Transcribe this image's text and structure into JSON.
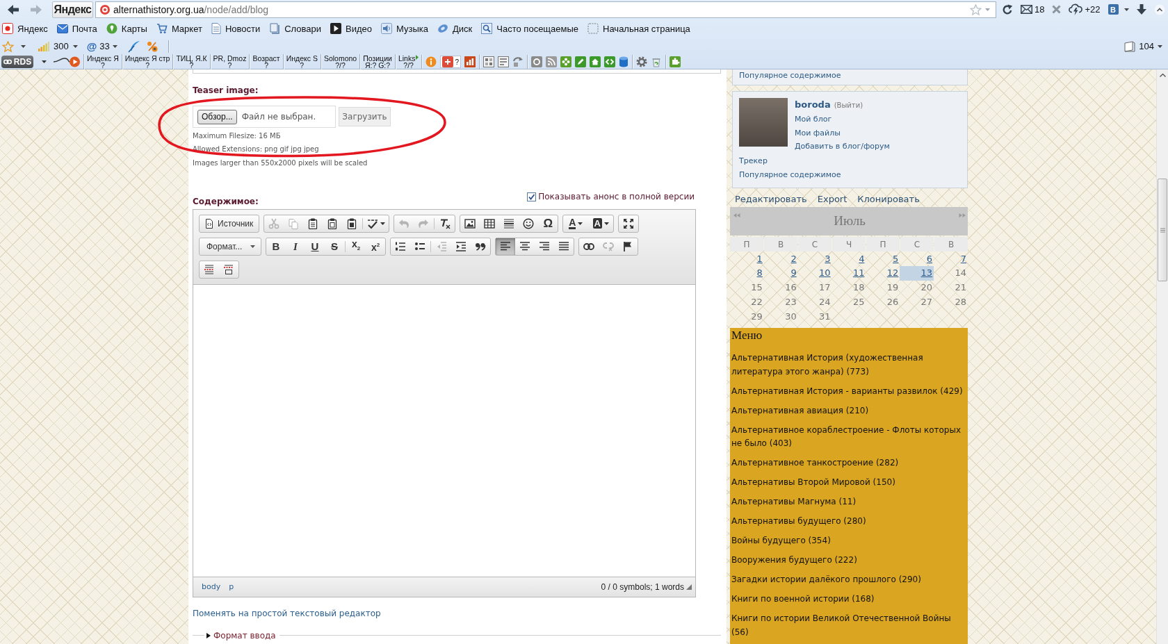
{
  "browser": {
    "nav": [
      {
        "kind": "back",
        "disabled": false
      },
      {
        "kind": "forward",
        "disabled": true
      }
    ],
    "home_button": "Яндекс",
    "address": {
      "host": "alternathistory.org.ua",
      "path": "/node/add/blog"
    },
    "tools": [
      {
        "kind": "refresh"
      },
      {
        "kind": "mail",
        "text": "18"
      },
      {
        "kind": "close"
      },
      {
        "kind": "weather",
        "text": "+22"
      },
      {
        "kind": "account",
        "text": "B"
      },
      {
        "kind": "download"
      },
      {
        "kind": "collapse"
      }
    ],
    "bookmarks": [
      {
        "kind": "yandex",
        "label": "Яндекс"
      },
      {
        "kind": "mail",
        "label": "Почта"
      },
      {
        "kind": "maps",
        "label": "Карты"
      },
      {
        "kind": "market",
        "label": "Маркет"
      },
      {
        "kind": "news",
        "label": "Новости"
      },
      {
        "kind": "dictionary",
        "label": "Словари"
      },
      {
        "kind": "video",
        "label": "Видео"
      },
      {
        "kind": "music",
        "label": "Музыка"
      },
      {
        "kind": "disk",
        "label": "Диск"
      },
      {
        "kind": "frequent",
        "label": "Часто посещаемые"
      },
      {
        "kind": "start",
        "label": "Начальная страница"
      }
    ],
    "widgets": [
      {
        "kind": "favorites"
      },
      {
        "kind": "rating",
        "text": "300"
      },
      {
        "kind": "mail-count",
        "glyph": "@",
        "text": "33"
      },
      {
        "kind": "feather"
      },
      {
        "kind": "percent"
      }
    ],
    "pages_counter": "104",
    "rds": {
      "badge": "RDS",
      "metrics": [
        {
          "kind": "plain",
          "label": "Индекс Я",
          "value": "?"
        },
        {
          "kind": "plain",
          "label": "Индекс Я стр",
          "value": "?"
        },
        {
          "kind": "plain",
          "label": "ТИЦ, Я.К",
          "value": "?"
        },
        {
          "kind": "plain",
          "label": "PR, Dmoz",
          "value": "?"
        },
        {
          "kind": "plain",
          "label": "Возраст",
          "value": "?"
        },
        {
          "kind": "plain",
          "label": "Индекс S",
          "value": "?"
        },
        {
          "kind": "plain",
          "label": "Solomono",
          "value": "?/?"
        },
        {
          "kind": "plain",
          "label": "Позиции",
          "value": "Я:? G:?"
        },
        {
          "kind": "dropdown",
          "label": "Links",
          "value": "?/?"
        }
      ],
      "tools": [
        [
          {
            "kind": "info"
          },
          {
            "kind": "plus",
            "text": "?"
          },
          {
            "kind": "chart"
          }
        ],
        [
          {
            "kind": "grid"
          },
          {
            "kind": "lines"
          },
          {
            "kind": "rotate"
          }
        ],
        [
          {
            "kind": "coin"
          },
          {
            "kind": "rss"
          },
          {
            "kind": "flower"
          },
          {
            "kind": "pencil"
          },
          {
            "kind": "home"
          },
          {
            "kind": "code"
          },
          {
            "kind": "database"
          }
        ],
        [
          {
            "kind": "gear"
          },
          {
            "kind": "recycle"
          }
        ],
        [
          {
            "kind": "puzzle"
          }
        ]
      ]
    }
  },
  "form": {
    "teaser": {
      "label": "Teaser image:",
      "browse_button": "Обзор...",
      "file_status": "Файл не выбран.",
      "upload_button": "Загрузить",
      "hints": [
        "Maximum Filesize: 16 МБ",
        "Allowed Extensions: png gif jpg jpeg",
        "Images larger than 550x2000 pixels will be scaled"
      ]
    },
    "annotations": [
      {
        "kind": "ellipse"
      }
    ],
    "content": {
      "label": "Содержимое:",
      "show_teaser": {
        "label": "Показывать анонс в полной версии",
        "checked": true
      },
      "editor": {
        "toolbar": [
          [
            [
              [
                {
                  "kind": "source",
                  "label": "Источник",
                  "disabled": false,
                  "selected": false
                }
              ]
            ],
            [
              [
                {
                  "kind": "cut",
                  "disabled": true,
                  "selected": false
                },
                {
                  "kind": "copy",
                  "disabled": true,
                  "selected": false
                },
                {
                  "kind": "paste",
                  "disabled": false,
                  "selected": false
                },
                {
                  "kind": "paste-text",
                  "disabled": false,
                  "selected": false
                },
                {
                  "kind": "paste-word",
                  "disabled": false,
                  "selected": false
                }
              ],
              [
                {
                  "kind": "spellcheck",
                  "disabled": false,
                  "selected": false
                }
              ]
            ],
            [
              [
                {
                  "kind": "undo",
                  "disabled": true,
                  "selected": false
                },
                {
                  "kind": "redo",
                  "disabled": true,
                  "selected": false
                }
              ],
              [
                {
                  "kind": "remove-format",
                  "disabled": false,
                  "selected": false
                }
              ]
            ],
            [
              [
                {
                  "kind": "image",
                  "disabled": false,
                  "selected": false
                },
                {
                  "kind": "table",
                  "disabled": false,
                  "selected": false
                },
                {
                  "kind": "rule",
                  "disabled": false,
                  "selected": false
                },
                {
                  "kind": "smiley",
                  "disabled": false,
                  "selected": false
                },
                {
                  "kind": "special-char",
                  "glyph": "Ω",
                  "disabled": false,
                  "selected": false
                }
              ]
            ],
            [
              [
                {
                  "kind": "text-color",
                  "glyph": "A",
                  "disabled": false,
                  "selected": false
                },
                {
                  "kind": "bg-color",
                  "glyph": "A",
                  "disabled": false,
                  "selected": false
                }
              ]
            ],
            [
              [
                {
                  "kind": "maximize",
                  "disabled": false,
                  "selected": false
                }
              ]
            ]
          ],
          [
            [
              [
                {
                  "kind": "format",
                  "label": "Формат...",
                  "disabled": false,
                  "selected": false
                }
              ]
            ],
            [
              [
                {
                  "kind": "bold",
                  "glyph": "B",
                  "disabled": false,
                  "selected": false
                },
                {
                  "kind": "italic",
                  "glyph": "I",
                  "disabled": false,
                  "selected": false
                },
                {
                  "kind": "underline",
                  "glyph": "U",
                  "disabled": false,
                  "selected": false
                },
                {
                  "kind": "strike",
                  "glyph": "S",
                  "disabled": false,
                  "selected": false
                }
              ],
              [
                {
                  "kind": "subscript",
                  "glyph": "x$_{2}$",
                  "disabled": false,
                  "selected": false
                },
                {
                  "kind": "superscript",
                  "glyph": "x$^{2}$",
                  "disabled": false,
                  "selected": false
                }
              ]
            ],
            [
              [
                {
                  "kind": "numbered-list",
                  "disabled": false,
                  "selected": false
                },
                {
                  "kind": "bullet-list",
                  "disabled": false,
                  "selected": false
                }
              ],
              [
                {
                  "kind": "outdent",
                  "disabled": true,
                  "selected": false
                },
                {
                  "kind": "indent",
                  "disabled": false,
                  "selected": false
                },
                {
                  "kind": "blockquote",
                  "disabled": false,
                  "selected": false
                }
              ]
            ],
            [
              [
                {
                  "kind": "align-left",
                  "disabled": false,
                  "selected": true
                },
                {
                  "kind": "align-center",
                  "disabled": false,
                  "selected": false
                },
                {
                  "kind": "align-right",
                  "disabled": false,
                  "selected": false
                },
                {
                  "kind": "justify",
                  "disabled": false,
                  "selected": false
                }
              ]
            ],
            [
              [
                {
                  "kind": "link",
                  "disabled": false,
                  "selected": false
                },
                {
                  "kind": "unlink",
                  "disabled": true,
                  "selected": false
                },
                {
                  "kind": "anchor",
                  "disabled": false,
                  "selected": false
                }
              ]
            ]
          ],
          [
            [
              [
                {
                  "kind": "page-break",
                  "disabled": false,
                  "selected": false
                },
                {
                  "kind": "teaser-break",
                  "disabled": false,
                  "selected": false
                }
              ]
            ]
          ]
        ],
        "path": [
          "body",
          "p"
        ],
        "counter": "0 / 0 symbols; 1 words"
      }
    },
    "switch_link": "Поменять на простой текстовый редактор",
    "input_format": {
      "label": "Формат ввода",
      "expanded": false
    }
  },
  "sidebar": {
    "top_links": [
      "Популярное содержимое"
    ],
    "user": {
      "name": "boroda",
      "logout": "(Выйти)",
      "links": [
        "Мой блог",
        "Мои файлы",
        "Добавить в блог/форум"
      ],
      "more_links": [
        "Трекер",
        "Популярное содержимое"
      ]
    },
    "actions": [
      "Редактировать",
      "Export",
      "Клонировать"
    ],
    "calendar": {
      "month": "Июль",
      "weekdays": [
        "П",
        "В",
        "С",
        "Ч",
        "П",
        "С",
        "В"
      ],
      "weeks": [
        [
          {
            "day": "1",
            "linked": true,
            "today": false
          },
          {
            "day": "2",
            "linked": true,
            "today": false
          },
          {
            "day": "3",
            "linked": true,
            "today": false
          },
          {
            "day": "4",
            "linked": true,
            "today": false
          },
          {
            "day": "5",
            "linked": true,
            "today": false
          },
          {
            "day": "6",
            "linked": true,
            "today": false
          },
          {
            "day": "7",
            "linked": true,
            "today": false
          }
        ],
        [
          {
            "day": "8",
            "linked": true,
            "today": false
          },
          {
            "day": "9",
            "linked": true,
            "today": false
          },
          {
            "day": "10",
            "linked": true,
            "today": false
          },
          {
            "day": "11",
            "linked": true,
            "today": false
          },
          {
            "day": "12",
            "linked": true,
            "today": false
          },
          {
            "day": "13",
            "linked": true,
            "today": true
          },
          {
            "day": "14",
            "linked": false,
            "today": false
          }
        ],
        [
          {
            "day": "15",
            "linked": false,
            "today": false
          },
          {
            "day": "16",
            "linked": false,
            "today": false
          },
          {
            "day": "17",
            "linked": false,
            "today": false
          },
          {
            "day": "18",
            "linked": false,
            "today": false
          },
          {
            "day": "19",
            "linked": false,
            "today": false
          },
          {
            "day": "20",
            "linked": false,
            "today": false
          },
          {
            "day": "21",
            "linked": false,
            "today": false
          }
        ],
        [
          {
            "day": "22",
            "linked": false,
            "today": false
          },
          {
            "day": "23",
            "linked": false,
            "today": false
          },
          {
            "day": "24",
            "linked": false,
            "today": false
          },
          {
            "day": "25",
            "linked": false,
            "today": false
          },
          {
            "day": "26",
            "linked": false,
            "today": false
          },
          {
            "day": "27",
            "linked": false,
            "today": false
          },
          {
            "day": "28",
            "linked": false,
            "today": false
          }
        ],
        [
          {
            "day": "29",
            "linked": false,
            "today": false
          },
          {
            "day": "30",
            "linked": false,
            "today": false
          },
          {
            "day": "31",
            "linked": false,
            "today": false
          }
        ]
      ]
    },
    "menu": {
      "title": "Меню",
      "items": [
        "Альтернативная История (художественная литература этого жанра) (773)",
        "Альтернативная История - варианты развилок (429)",
        "Альтернативная авиация (210)",
        "Альтернативное кораблестроение - Флоты которых не было (403)",
        "Альтернативное танкостроение (282)",
        "Альтернативы Второй Мировой (150)",
        "Альтернативы Магнума (11)",
        "Альтернативы будущего (280)",
        "Войны будущего (354)",
        "Вооружения будущего (222)",
        "Загадки истории далёкого прошлого (290)",
        "Книги по военной истории (168)",
        "Книги по истории Великой Отечественной Войны (56)"
      ]
    }
  }
}
